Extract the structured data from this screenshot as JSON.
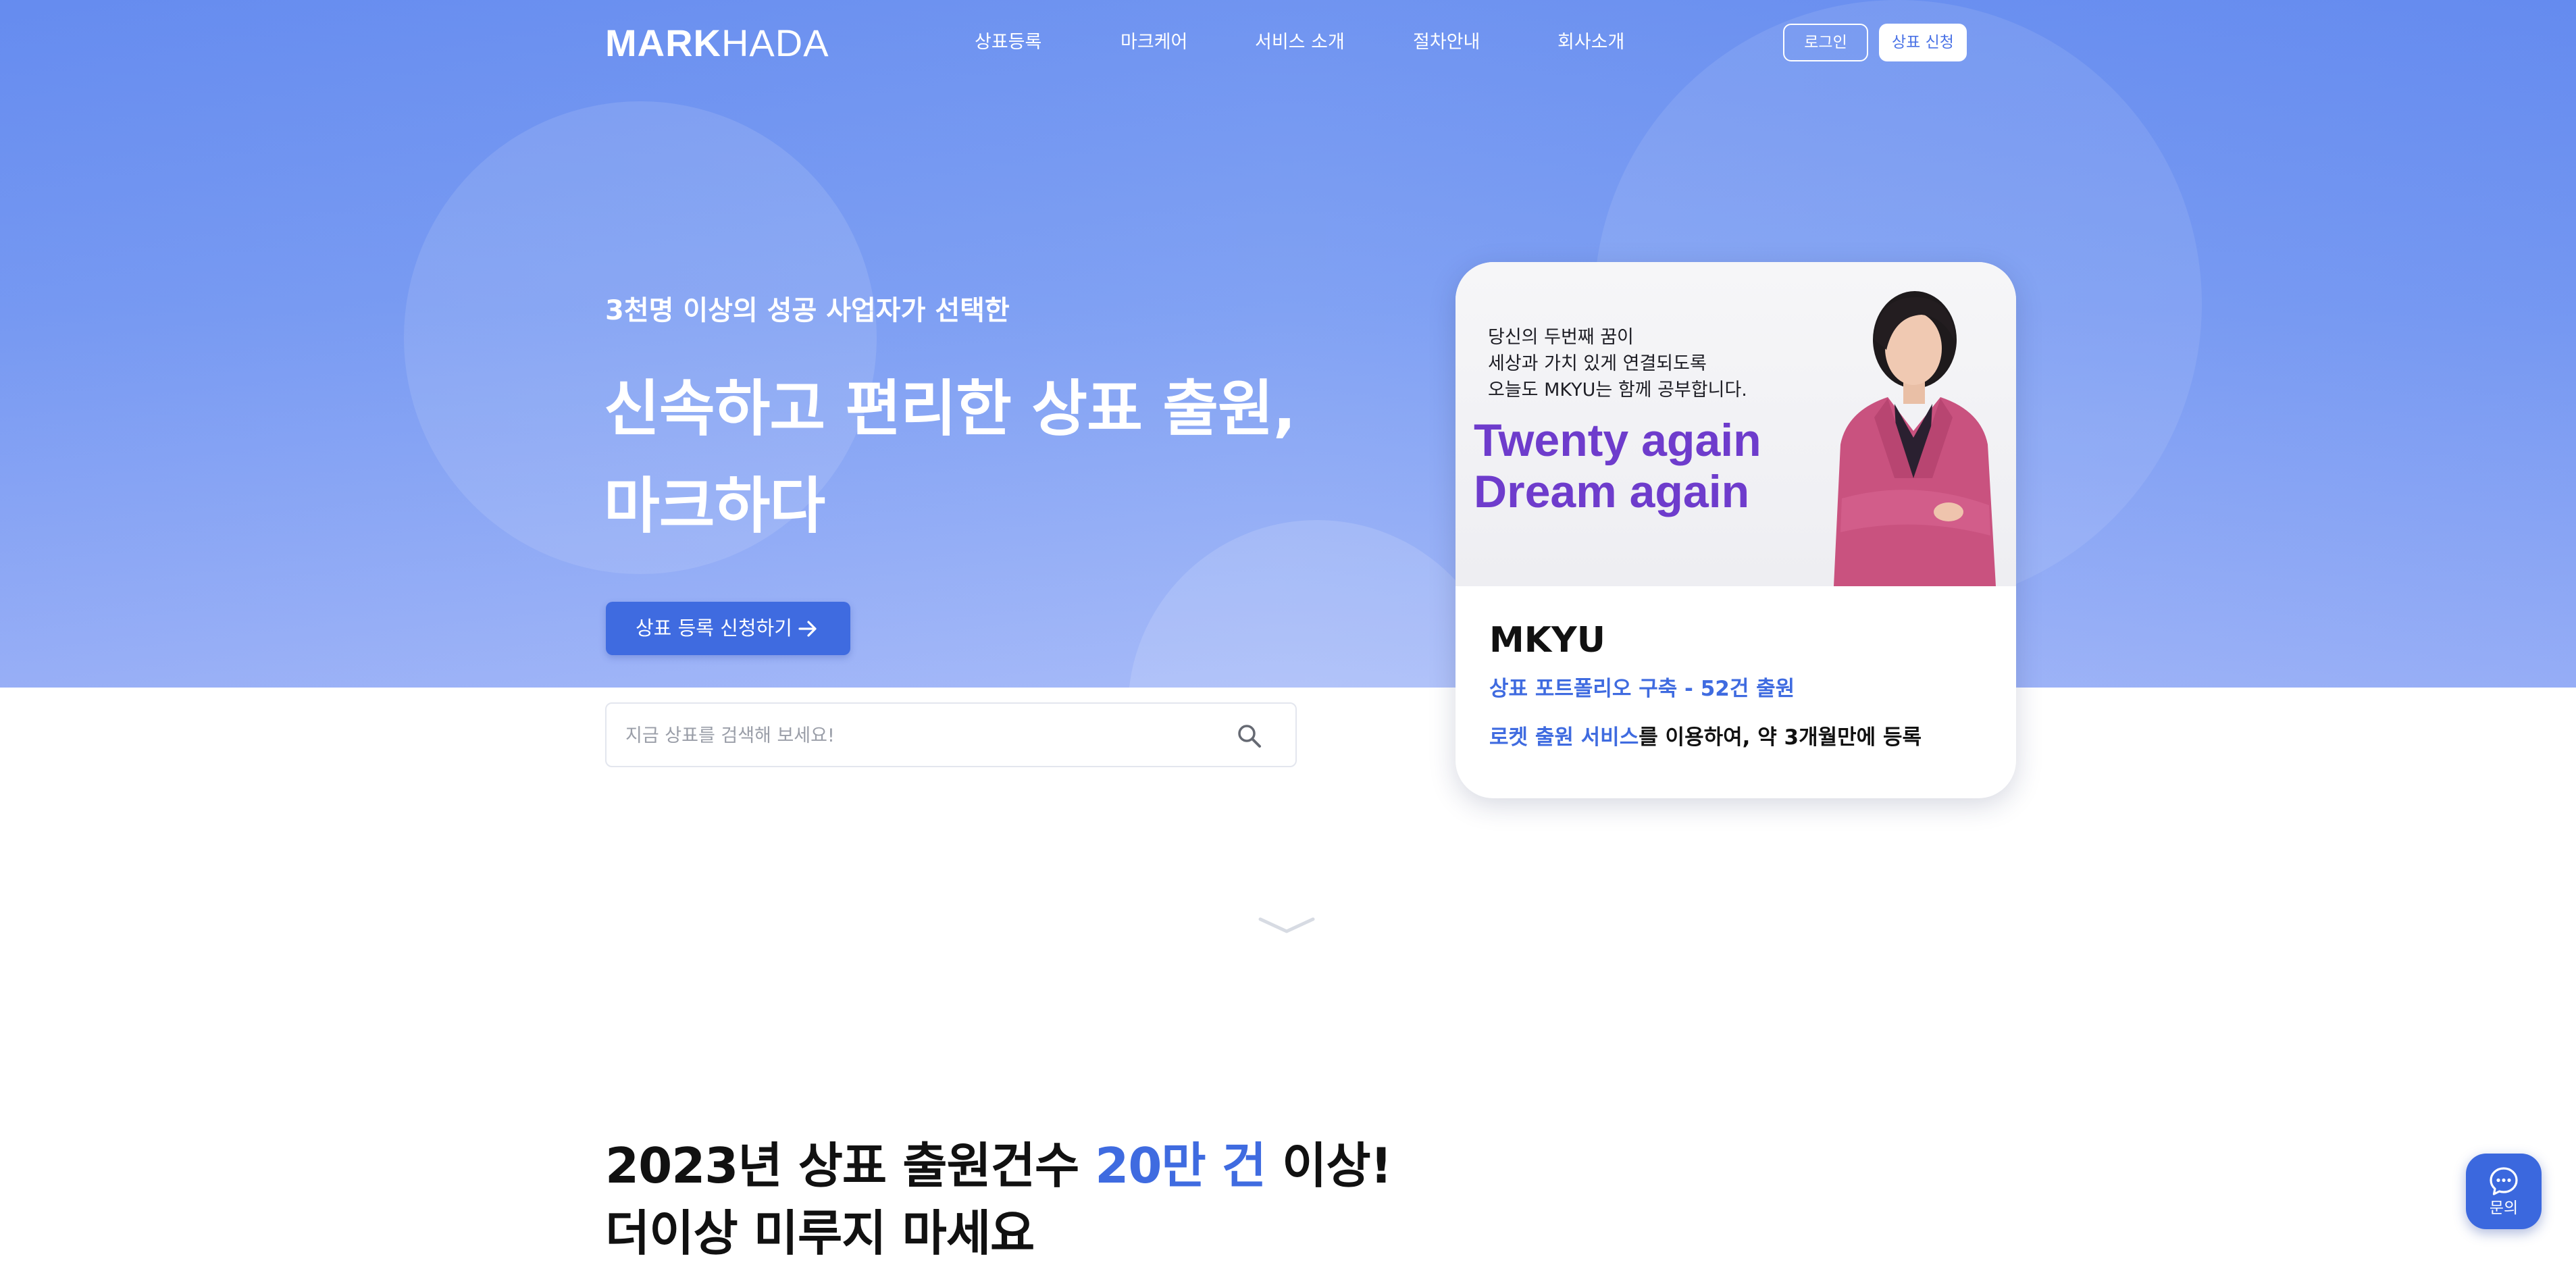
{
  "brand": {
    "logo_bold": "MARK",
    "logo_light": "HADA"
  },
  "nav": {
    "items": [
      {
        "label": "상표등록"
      },
      {
        "label": "마크케어"
      },
      {
        "label": "서비스 소개"
      },
      {
        "label": "절차안내"
      },
      {
        "label": "회사소개"
      }
    ],
    "login_label": "로그인",
    "apply_label": "상표 신청"
  },
  "hero": {
    "subtitle": "3천명 이상의 성공 사업자가 선택한",
    "title_line1": "신속하고 편리한 상표 출원,",
    "title_line2": "마크하다",
    "cta_label": "상표 등록 신청하기"
  },
  "search": {
    "placeholder": "지금 상표를 검색해 보세요!",
    "value": ""
  },
  "testimonial": {
    "quote_lines": [
      "당신의 두번째 꿈이",
      "세상과 가치 있게 연결되도록",
      "오늘도 MKYU는 함께 공부합니다."
    ],
    "slogan_line1": "Twenty again",
    "slogan_line2": "Dream again",
    "name": "MKYU",
    "line1": "상표 포트폴리오 구축 - 52건 출원",
    "line2_highlight": "로켓 출원 서비스",
    "line2_rest": "를 이용하여, 약 3개월만에 등록"
  },
  "stats": {
    "line1_prefix": "2023년 상표 출원건수 ",
    "line1_accent": "20만 건",
    "line1_suffix": " 이상!",
    "line2": "더이상 미루지 마세요"
  },
  "chat": {
    "label": "문의"
  },
  "colors": {
    "primary": "#3f6be0",
    "hero_top": "#6a90f0",
    "hero_bottom": "#a2b7f8",
    "slogan": "#6e3ccc",
    "jacket": "#c9527f"
  },
  "icons": [
    "arrow-right-icon",
    "search-icon",
    "chevron-down-icon",
    "chat-bubble-icon"
  ]
}
